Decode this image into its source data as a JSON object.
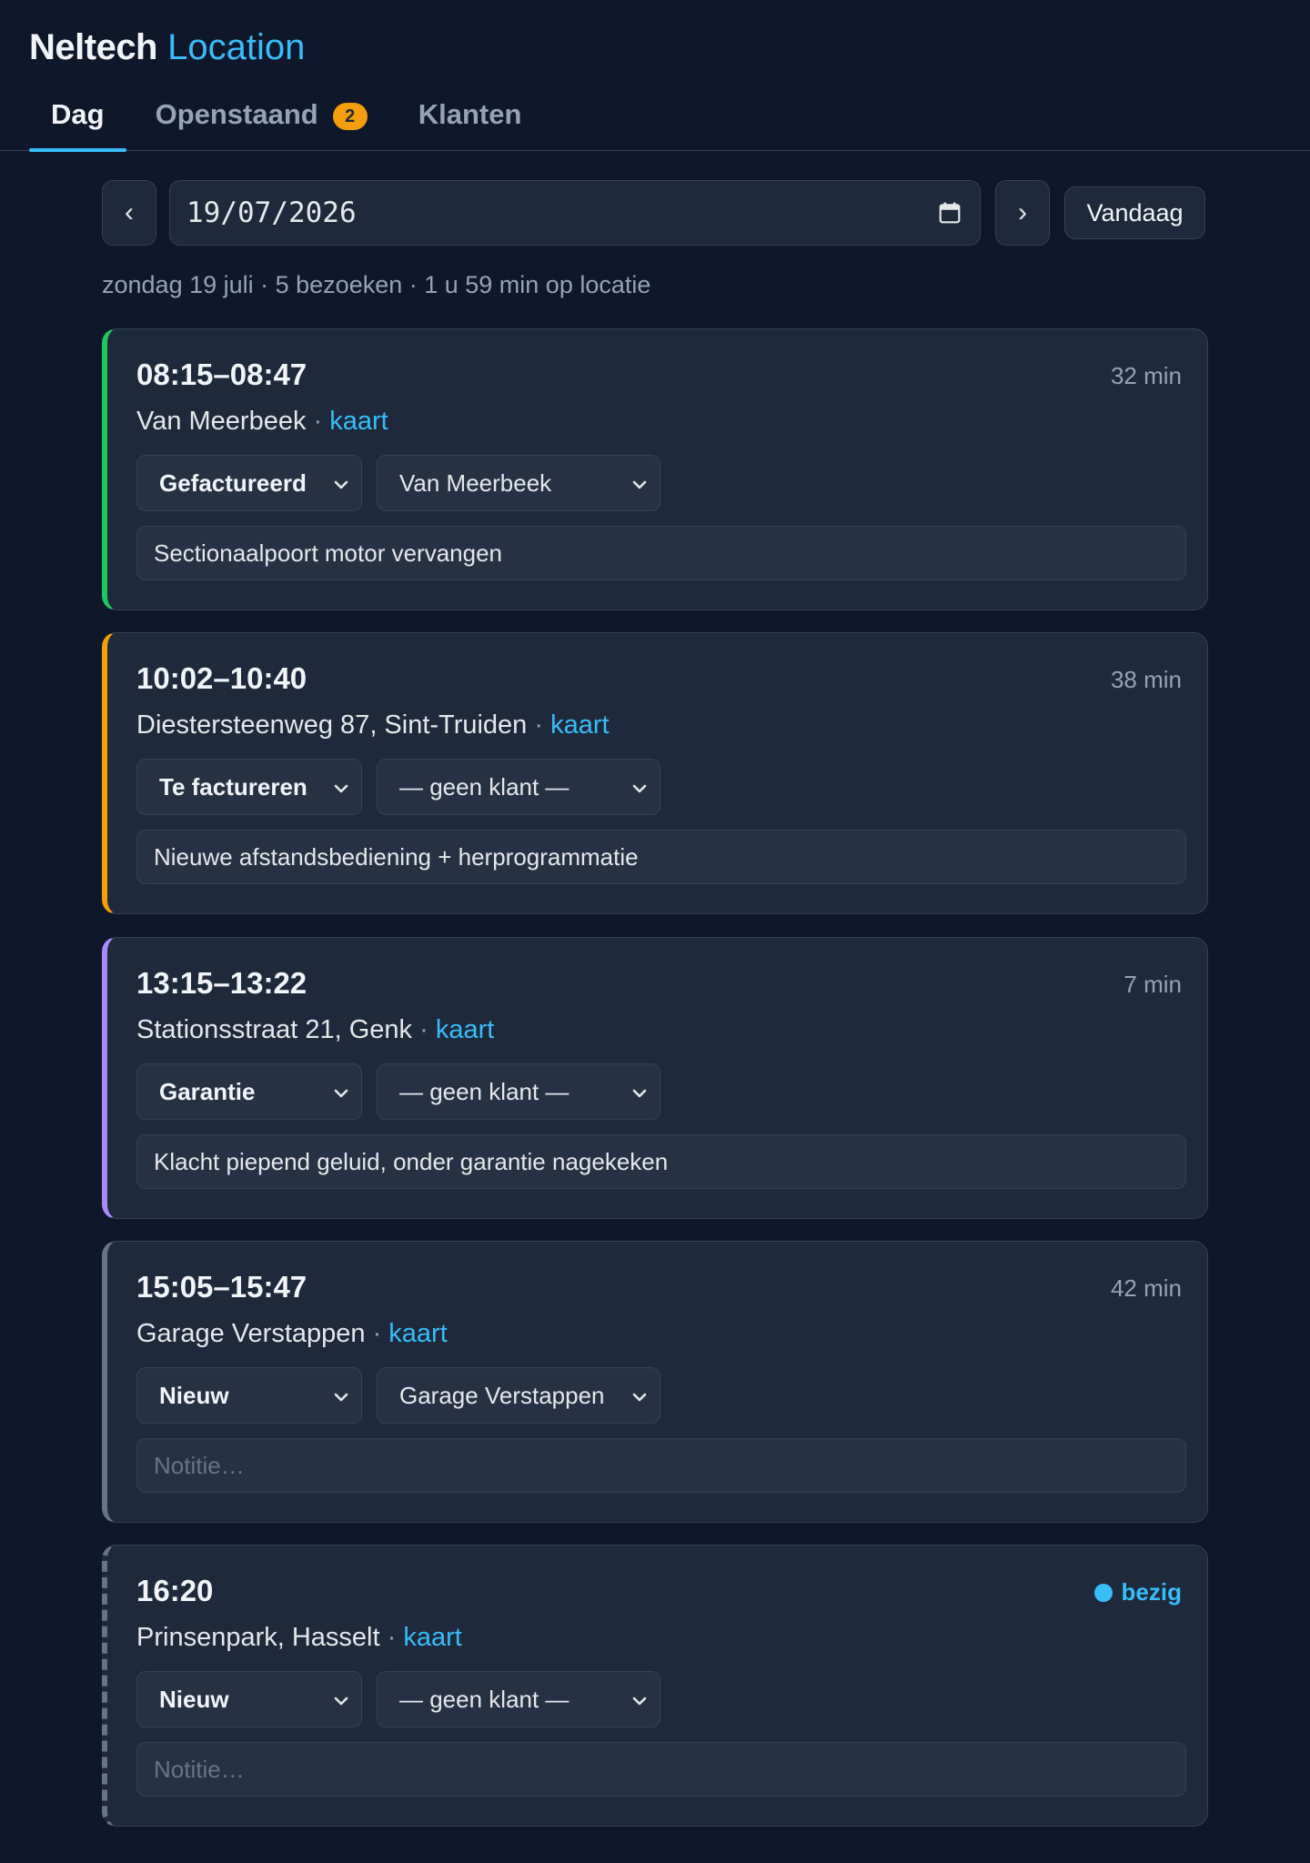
{
  "brand": {
    "name": "Neltech",
    "accent": "Location"
  },
  "tabs": [
    {
      "label": "Dag",
      "active": true
    },
    {
      "label": "Openstaand",
      "badge": "2"
    },
    {
      "label": "Klanten"
    }
  ],
  "date": {
    "prev_glyph": "‹",
    "next_glyph": "›",
    "value": "19/07/2026",
    "today_label": "Vandaag",
    "summary": "zondag 19 juli · 5 bezoeken · 1 u 59 min op locatie"
  },
  "visits": [
    {
      "time": "08:15–08:47",
      "duration": "32 min",
      "location": "Van Meerbeek",
      "map_label": "kaart",
      "status": "Gefactureerd",
      "client": "Van Meerbeek",
      "note": "Sectionaalpoort motor vervangen",
      "note_placeholder": "Notitie…",
      "accent_color": "#22c55e"
    },
    {
      "time": "10:02–10:40",
      "duration": "38 min",
      "location": "Diestersteenweg 87, Sint-Truiden",
      "map_label": "kaart",
      "status": "Te factureren",
      "client": "— geen klant —",
      "note": "Nieuwe afstandsbediening + herprogrammatie",
      "note_placeholder": "Notitie…",
      "accent_color": "#f59e0b"
    },
    {
      "time": "13:15–13:22",
      "duration": "7 min",
      "location": "Stationsstraat 21, Genk",
      "map_label": "kaart",
      "status": "Garantie",
      "client": "— geen klant —",
      "note": "Klacht piepend geluid, onder garantie nagekeken",
      "note_placeholder": "Notitie…",
      "accent_color": "#a78bfa"
    },
    {
      "time": "15:05–15:47",
      "duration": "42 min",
      "location": "Garage Verstappen",
      "map_label": "kaart",
      "status": "Nieuw",
      "client": "Garage Verstappen",
      "note": "",
      "note_placeholder": "Notitie…",
      "accent_color": "#64748b"
    },
    {
      "time": "16:20",
      "busy_label": "bezig",
      "location": "Prinsenpark, Hasselt",
      "map_label": "kaart",
      "status": "Nieuw",
      "client": "— geen klant —",
      "note": "",
      "note_placeholder": "Notitie…",
      "accent_color": "#64748b"
    }
  ]
}
